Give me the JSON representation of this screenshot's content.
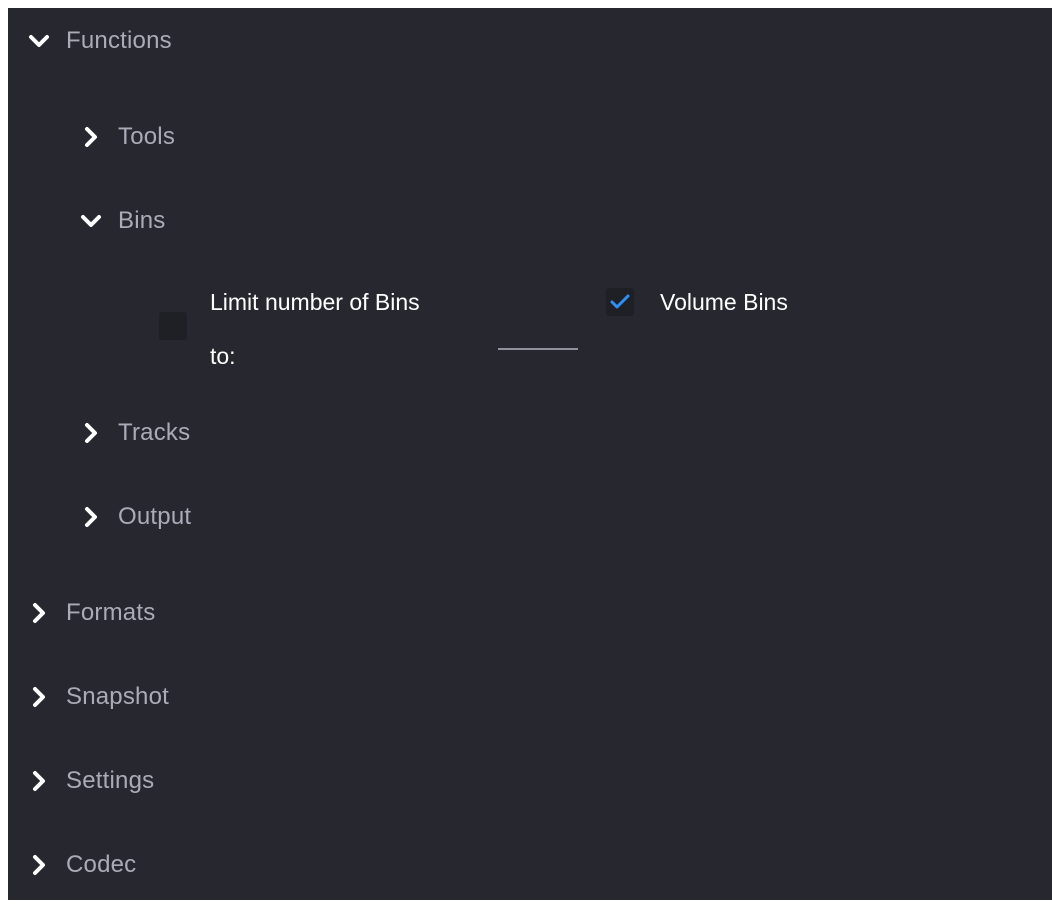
{
  "tree": {
    "functions": {
      "label": "Functions",
      "expanded": true,
      "icon": "chevron-down-icon",
      "children": {
        "tools": {
          "label": "Tools",
          "expanded": false,
          "icon": "chevron-right-icon"
        },
        "bins": {
          "label": "Bins",
          "expanded": true,
          "icon": "chevron-down-icon",
          "options": {
            "limit_checked": false,
            "limit_label_line1": "Limit number of Bins",
            "limit_label_line2": "to:",
            "limit_value": "",
            "volume_checked": true,
            "volume_label": "Volume Bins"
          }
        },
        "tracks": {
          "label": "Tracks",
          "expanded": false,
          "icon": "chevron-right-icon"
        },
        "output": {
          "label": "Output",
          "expanded": false,
          "icon": "chevron-right-icon"
        }
      }
    },
    "formats": {
      "label": "Formats",
      "expanded": false,
      "icon": "chevron-right-icon"
    },
    "snapshot": {
      "label": "Snapshot",
      "expanded": false,
      "icon": "chevron-right-icon"
    },
    "settings": {
      "label": "Settings",
      "expanded": false,
      "icon": "chevron-right-icon"
    },
    "codec": {
      "label": "Codec",
      "expanded": false,
      "icon": "chevron-right-icon"
    }
  },
  "colors": {
    "background": "#27282f",
    "label": "#a9acb6",
    "option_text": "#ffffff",
    "checkmark": "#2f8ff5",
    "chevron": "#ffffff"
  }
}
